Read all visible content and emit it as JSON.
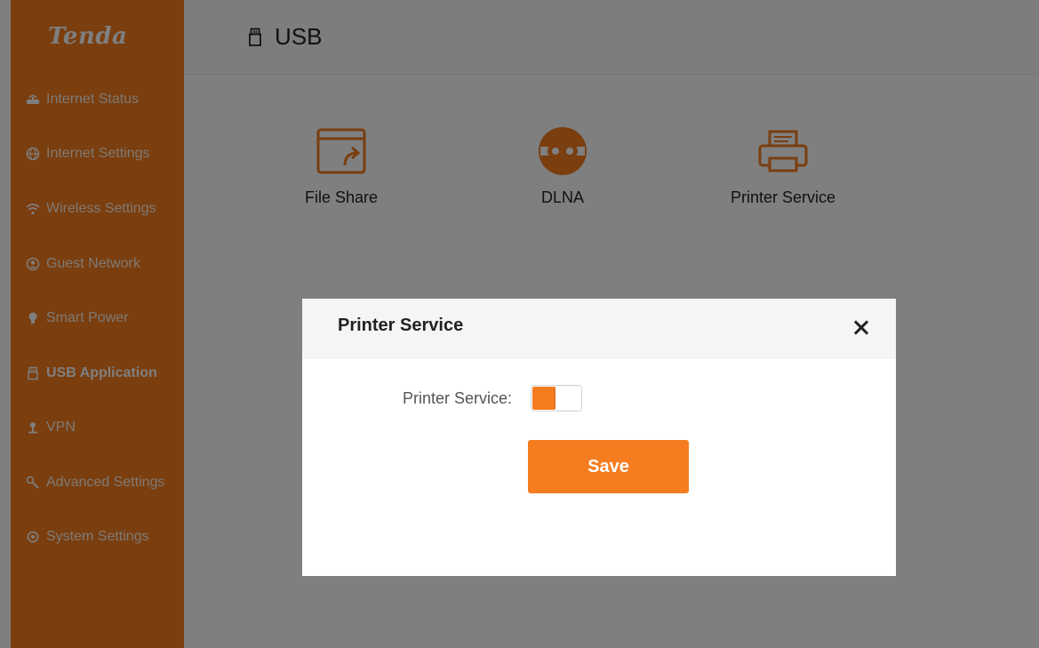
{
  "brand": {
    "logo": "Tenda",
    "accent_color": "#f57c1f"
  },
  "sidebar": {
    "items": [
      {
        "label": "Internet Status",
        "icon": "router-icon"
      },
      {
        "label": "Internet Settings",
        "icon": "globe-icon"
      },
      {
        "label": "Wireless Settings",
        "icon": "wifi-icon"
      },
      {
        "label": "Guest Network",
        "icon": "guest-icon"
      },
      {
        "label": "Smart Power",
        "icon": "bulb-icon"
      },
      {
        "label": "USB Application",
        "icon": "usb-icon",
        "active": true
      },
      {
        "label": "VPN",
        "icon": "vpn-icon"
      },
      {
        "label": "Advanced Settings",
        "icon": "wrench-icon"
      },
      {
        "label": "System Settings",
        "icon": "gear-icon"
      }
    ]
  },
  "header": {
    "title": "USB",
    "icon": "usb-icon"
  },
  "apps": [
    {
      "label": "File Share",
      "icon": "file-share-icon"
    },
    {
      "label": "DLNA",
      "icon": "dlna-icon"
    },
    {
      "label": "Printer Service",
      "icon": "printer-icon"
    }
  ],
  "modal": {
    "title": "Printer Service",
    "field_label": "Printer Service:",
    "toggle_state": "on",
    "save_label": "Save"
  }
}
